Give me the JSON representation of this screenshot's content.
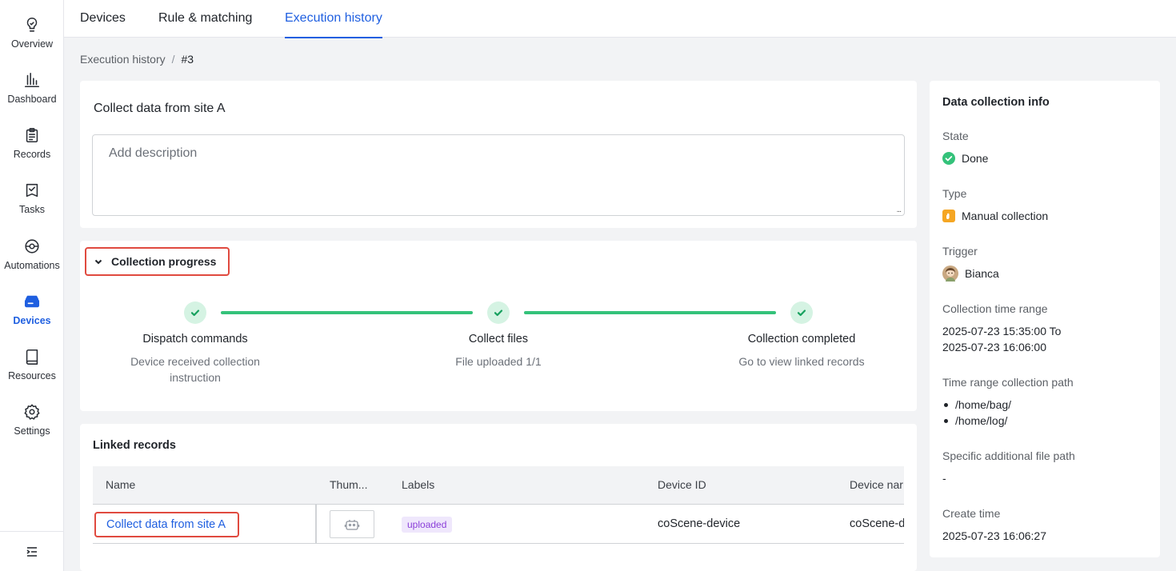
{
  "sidebar": {
    "items": [
      {
        "label": "Overview",
        "icon": "bulb-icon"
      },
      {
        "label": "Dashboard",
        "icon": "bar-chart-icon"
      },
      {
        "label": "Records",
        "icon": "clipboard-icon"
      },
      {
        "label": "Tasks",
        "icon": "task-check-icon"
      },
      {
        "label": "Automations",
        "icon": "automation-icon"
      },
      {
        "label": "Devices",
        "icon": "device-icon",
        "active": true
      },
      {
        "label": "Resources",
        "icon": "book-icon"
      },
      {
        "label": "Settings",
        "icon": "gear-icon"
      }
    ],
    "collapse_icon": "collapse-sidebar-icon"
  },
  "tabs": [
    {
      "label": "Devices"
    },
    {
      "label": "Rule & matching"
    },
    {
      "label": "Execution history",
      "active": true
    }
  ],
  "breadcrumb": {
    "parent": "Execution history",
    "separator": "/",
    "current": "#3"
  },
  "task": {
    "title": "Collect data from site A",
    "description_placeholder": "Add description"
  },
  "progress": {
    "section_label": "Collection progress",
    "steps": [
      {
        "title": "Dispatch commands",
        "subtitle_line1": "Device received collection",
        "subtitle_line2": "instruction"
      },
      {
        "title": "Collect files",
        "subtitle_line1": "File uploaded 1/1",
        "subtitle_line2": ""
      },
      {
        "title": "Collection completed",
        "subtitle_line1": "Go to view linked records",
        "subtitle_line2": ""
      }
    ]
  },
  "linked_records": {
    "title": "Linked records",
    "columns": [
      "Name",
      "Thum...",
      "Labels",
      "Device ID",
      "Device nar"
    ],
    "rows": [
      {
        "name": "Collect data from site A",
        "label": "uploaded",
        "device_id": "coScene-device",
        "device_name": "coScene-d"
      }
    ]
  },
  "info": {
    "title": "Data collection info",
    "state_label": "State",
    "state_value": "Done",
    "type_label": "Type",
    "type_value": "Manual collection",
    "trigger_label": "Trigger",
    "trigger_value": "Bianca",
    "time_range_label": "Collection time range",
    "time_range_line1": "2025-07-23 15:35:00 To",
    "time_range_line2": "2025-07-23 16:06:00",
    "paths_label": "Time range collection path",
    "paths": [
      "/home/bag/",
      "/home/log/"
    ],
    "extra_path_label": "Specific additional file path",
    "extra_path_value": "-",
    "create_time_label": "Create time",
    "create_time_value": "2025-07-23 16:06:27"
  },
  "colors": {
    "accent": "#1f5fe0",
    "success": "#34c27a",
    "highlight": "#e04a3f",
    "badge": "#8b3fd9",
    "type_icon": "#f5a623"
  }
}
